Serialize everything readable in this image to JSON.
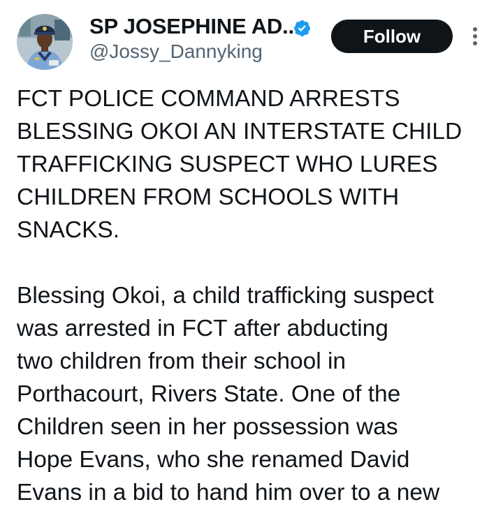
{
  "author": {
    "display_name": "SP JOSEPHINE AD...",
    "handle": "@Jossy_Dannyking",
    "verified": true,
    "avatar_icon": "police-officer-avatar"
  },
  "actions": {
    "follow_label": "Follow",
    "more_icon": "more-vertical-icon"
  },
  "tweet": {
    "headline": "FCT POLICE COMMAND ARRESTS\nBLESSING OKOI AN INTERSTATE CHILD\nTRAFFICKING SUSPECT WHO LURES\nCHILDREN FROM SCHOOLS WITH\nSNACKS.",
    "body": "Blessing Okoi, a child trafficking suspect\nwas arrested in FCT after abducting\ntwo children from their school in\nPorthacourt, Rivers State. One of the\nChildren seen in her possession was\nHope Evans, who she renamed David\nEvans in a bid to hand him over to a new"
  },
  "colors": {
    "text": "#0f1419",
    "secondary_text": "#536471",
    "button_bg": "#0f1419",
    "verified": "#1d9bf0"
  }
}
